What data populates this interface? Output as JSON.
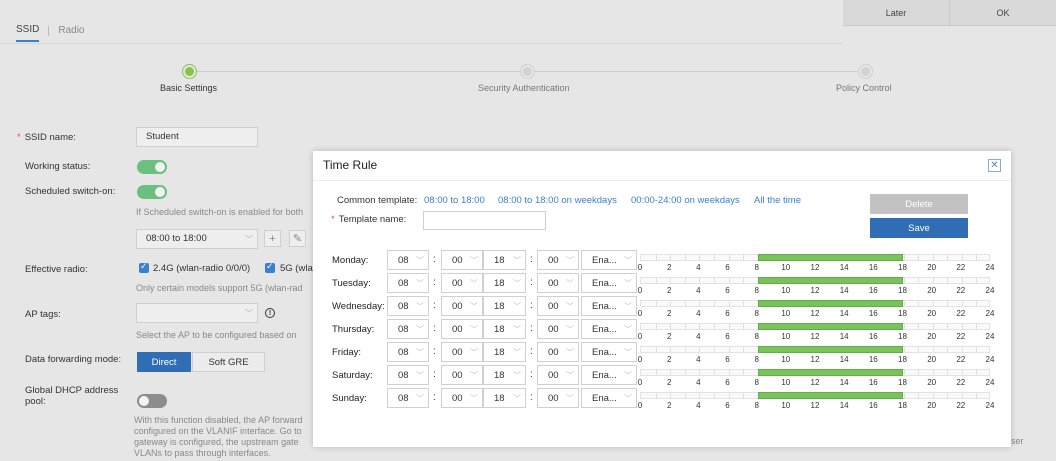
{
  "topbar": {
    "later": "Later",
    "ok": "OK"
  },
  "tabs": [
    {
      "label": "SSID",
      "active": true
    },
    {
      "label": "Radio",
      "active": false
    }
  ],
  "steps": [
    {
      "label": "Basic Settings",
      "active": true
    },
    {
      "label": "Security Authentication",
      "active": false
    },
    {
      "label": "Policy Control",
      "active": false
    }
  ],
  "form": {
    "ssid_name_label": "SSID name:",
    "ssid_name_value": "Student",
    "working_status_label": "Working status:",
    "scheduled_label": "Scheduled switch-on:",
    "scheduled_hint": "If Scheduled switch-on is enabled for both",
    "schedule_value": "08:00 to 18:00",
    "effective_radio_label": "Effective radio:",
    "radio_24": "2.4G (wlan-radio 0/0/0)",
    "radio_5": "5G (wla",
    "radio_hint": "Only certain models support 5G (wlan-rad",
    "ap_tags_label": "AP tags:",
    "ap_tags_hint": "Select the AP to be configured based on",
    "forwarding_label": "Data forwarding mode:",
    "forwarding_direct": "Direct",
    "forwarding_gre": "Soft GRE",
    "dhcp_label_1": "Global DHCP address",
    "dhcp_label_2": "pool:",
    "dhcp_hint": [
      "With this function disabled, the AP forward",
      "configured on the VLANIF interface. Go to",
      "gateway is configured, the upstream gate",
      "VLANs to pass through interfaces."
    ],
    "right_fragment": "ser"
  },
  "modal": {
    "title": "Time Rule",
    "common_template_label": "Common template:",
    "templates": [
      "08:00 to 18:00",
      "08:00 to 18:00 on weekdays",
      "00:00-24:00 on weekdays",
      "All the time"
    ],
    "template_name_label": "Template name:",
    "template_name_value": "",
    "delete_label": "Delete",
    "save_label": "Save",
    "hour_labels": [
      "0",
      "2",
      "4",
      "6",
      "8",
      "10",
      "12",
      "14",
      "16",
      "18",
      "20",
      "22",
      "24"
    ],
    "rows": [
      {
        "day": "Monday:",
        "start_h": "08",
        "start_m": "00",
        "end_h": "18",
        "end_m": "00",
        "action": "Ena...",
        "from": 8,
        "to": 18
      },
      {
        "day": "Tuesday:",
        "start_h": "08",
        "start_m": "00",
        "end_h": "18",
        "end_m": "00",
        "action": "Ena...",
        "from": 8,
        "to": 18
      },
      {
        "day": "Wednesday:",
        "start_h": "08",
        "start_m": "00",
        "end_h": "18",
        "end_m": "00",
        "action": "Ena...",
        "from": 8,
        "to": 18
      },
      {
        "day": "Thursday:",
        "start_h": "08",
        "start_m": "00",
        "end_h": "18",
        "end_m": "00",
        "action": "Ena...",
        "from": 8,
        "to": 18
      },
      {
        "day": "Friday:",
        "start_h": "08",
        "start_m": "00",
        "end_h": "18",
        "end_m": "00",
        "action": "Ena...",
        "from": 8,
        "to": 18
      },
      {
        "day": "Saturday:",
        "start_h": "08",
        "start_m": "00",
        "end_h": "18",
        "end_m": "00",
        "action": "Ena...",
        "from": 8,
        "to": 18
      },
      {
        "day": "Sunday:",
        "start_h": "08",
        "start_m": "00",
        "end_h": "18",
        "end_m": "00",
        "action": "Ena...",
        "from": 8,
        "to": 18
      }
    ]
  }
}
